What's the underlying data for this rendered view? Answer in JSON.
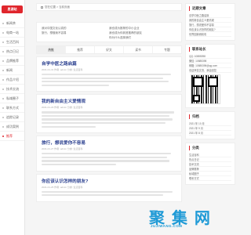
{
  "brand": {
    "logo_text": "思源站"
  },
  "sidebar": {
    "items": [
      {
        "label": "新闻茶"
      },
      {
        "label": "电商一站"
      },
      {
        "label": "生活百科"
      },
      {
        "label": "热点日记"
      },
      {
        "label": "品牌推荐"
      },
      {
        "label": "新闻"
      },
      {
        "label": "作品介绍"
      },
      {
        "label": "技术交流"
      },
      {
        "label": "私域圈子"
      },
      {
        "label": "联系方式"
      },
      {
        "label": "追踪记录"
      },
      {
        "label": "成功案例"
      },
      {
        "label": "推荐"
      }
    ],
    "active_index": 12
  },
  "breadcrumb": {
    "text": "您在位置 > 当前页面"
  },
  "links": {
    "rows": [
      [
        "我对中国文化认真的",
        "我也成为推荐的中小企业"
      ],
      [
        "旅行、想做我不容易",
        "我也成为你到底推荐的朋友"
      ],
      [
        "",
        "你为什么选择我们"
      ]
    ]
  },
  "tabs": [
    {
      "label": "热推"
    },
    {
      "label": "推荐"
    },
    {
      "label": "好文"
    },
    {
      "label": "读书"
    },
    {
      "label": "专题"
    }
  ],
  "articles": [
    {
      "title": "自学中医之路启篇",
      "meta": "2021-01-31   作者: admin   分类: 生活百科",
      "lines": 4
    },
    {
      "title": "我的新自由主义爱情观",
      "meta": "2021-01-29   作者: admin   分类: 生活百科",
      "lines": 5
    },
    {
      "title": "旅行，想说爱你不容易",
      "meta": "2021-01-27   作者: admin   分类: 生活百科",
      "lines": 4
    },
    {
      "title": "你应该认识怎样的朋友?",
      "meta": "2021-01-25   作者: admin   分类: 生活百科",
      "lines": 3
    }
  ],
  "right": {
    "recent": {
      "title": "近期文章",
      "items": [
        "自学中医之路启篇",
        "我的新自由主义爱情观",
        "旅行，想说爱你不容易",
        "你应该认识怎样的朋友?",
        "世界因我而精彩"
      ]
    },
    "contact": {
      "title": "联系站长",
      "items": [
        "QQ: 10885398",
        "微信: 10885398",
        "邮箱: 10885398@qq.com",
        "欢迎来信交流，我会回复"
      ]
    },
    "archive": {
      "title": "归档",
      "items": [
        "2021 年 10 月",
        "2021 年 9 月",
        "2021 年 8 月"
      ]
    },
    "categories": {
      "title": "分类",
      "items": [
        "生活百科",
        "热点日记",
        "技术交流",
        "品牌推荐",
        "私域圈子",
        "联系方式"
      ]
    }
  },
  "watermark": {
    "text": "聚 集 网",
    "sub": "JUJIWANG.COM"
  }
}
